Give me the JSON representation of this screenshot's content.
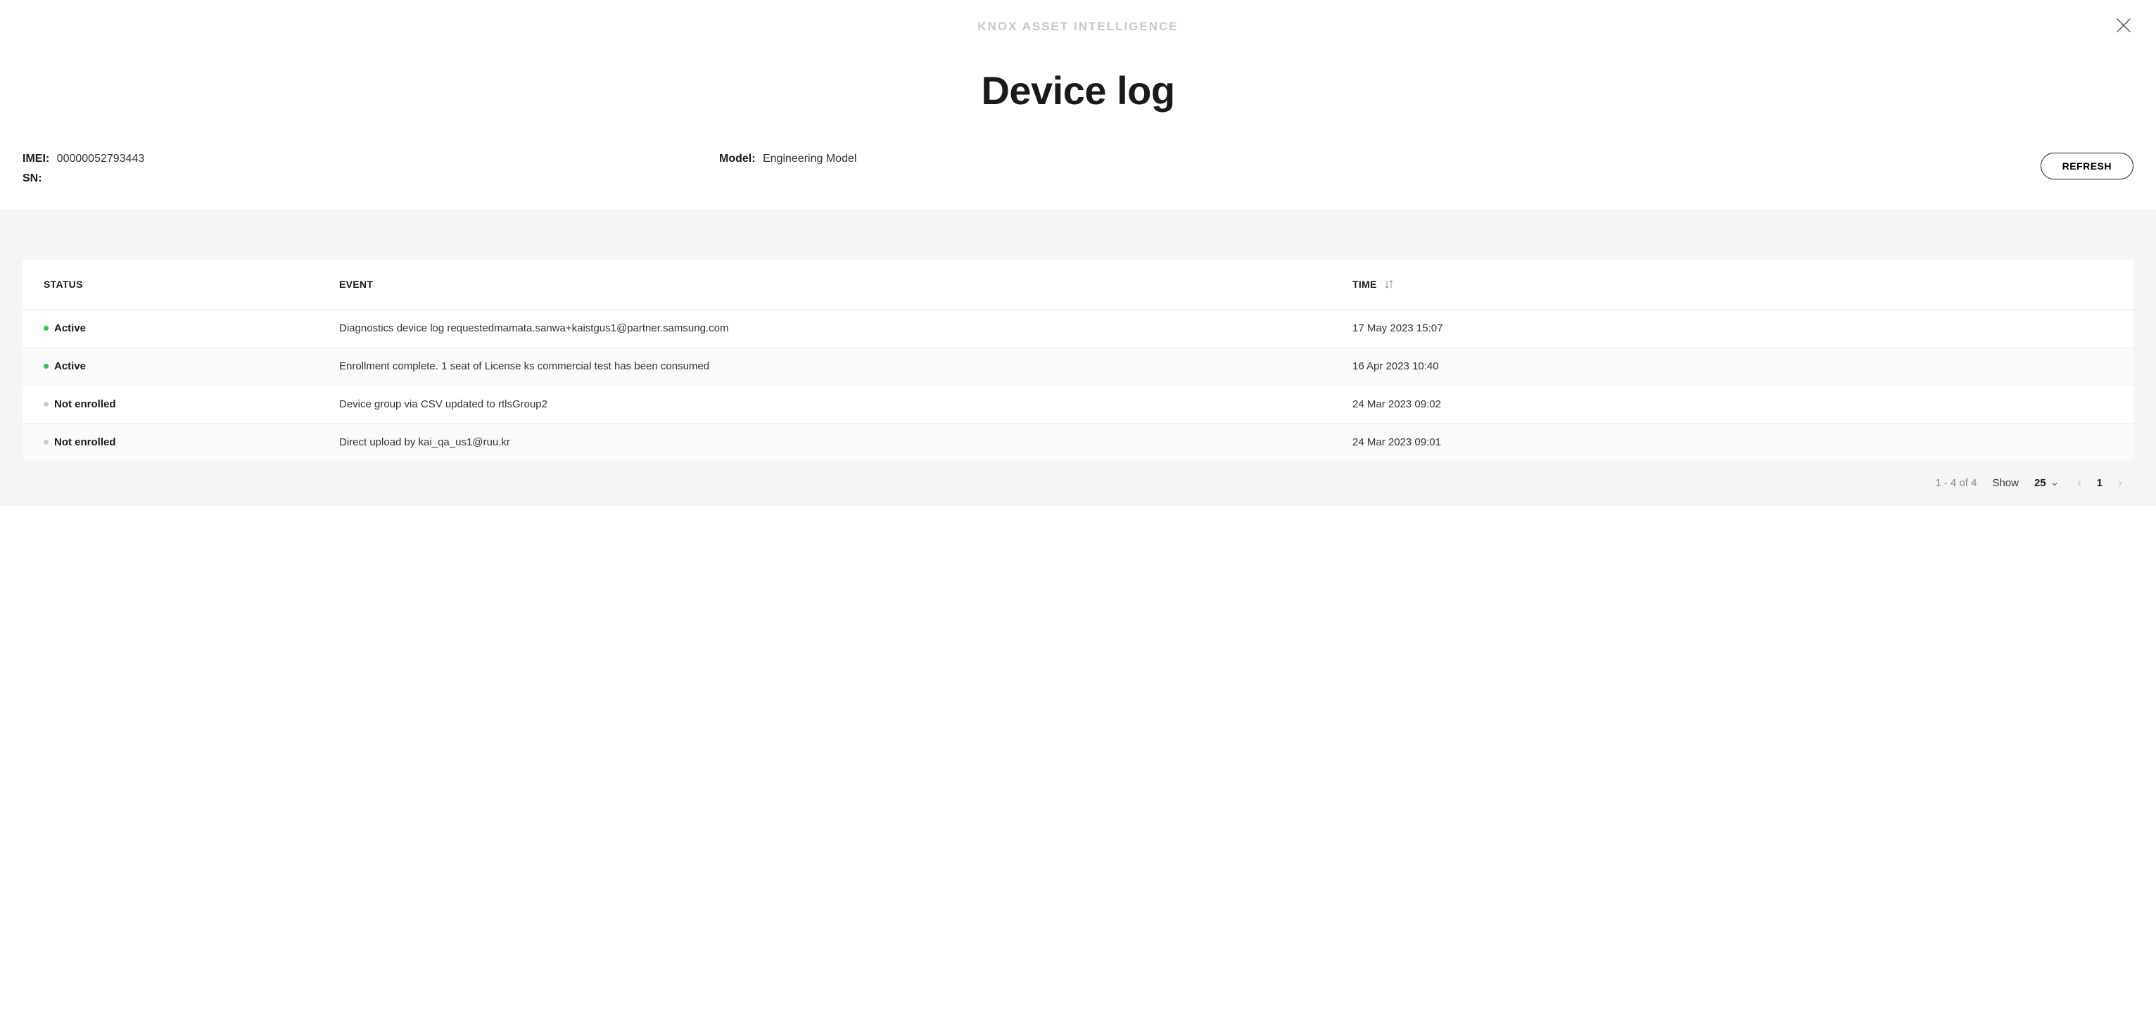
{
  "brand": "KNOX ASSET INTELLIGENCE",
  "title": "Device log",
  "meta": {
    "imei_label": "IMEI:",
    "imei_value": "00000052793443",
    "sn_label": "SN:",
    "sn_value": "",
    "model_label": "Model:",
    "model_value": "Engineering Model"
  },
  "buttons": {
    "refresh": "REFRESH"
  },
  "table": {
    "headers": {
      "status": "STATUS",
      "event": "EVENT",
      "time": "TIME"
    },
    "rows": [
      {
        "status": "Active",
        "active": true,
        "event": "Diagnostics device log requestedmamata.sanwa+kaistgus1@partner.samsung.com",
        "time": "17 May 2023 15:07"
      },
      {
        "status": "Active",
        "active": true,
        "event": "Enrollment complete. 1 seat of License ks commercial test has been consumed",
        "time": "16 Apr 2023 10:40"
      },
      {
        "status": "Not enrolled",
        "active": false,
        "event": "Device group via CSV updated to rtlsGroup2",
        "time": "24 Mar 2023 09:02"
      },
      {
        "status": "Not enrolled",
        "active": false,
        "event": "Direct upload by kai_qa_us1@ruu.kr",
        "time": "24 Mar 2023 09:01"
      }
    ]
  },
  "pager": {
    "range": "1 - 4 of 4",
    "show_label": "Show",
    "page_size": "25",
    "page": "1"
  }
}
